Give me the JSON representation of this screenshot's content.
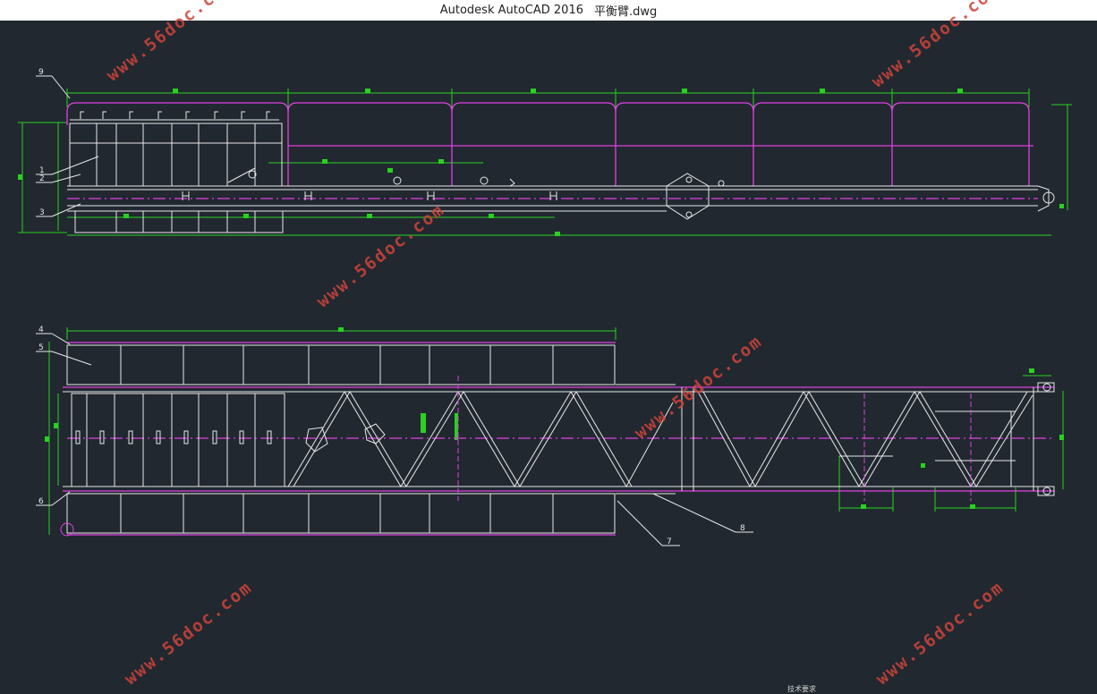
{
  "window": {
    "app_title": "Autodesk AutoCAD 2016",
    "file_name": "平衡臂.dwg"
  },
  "callouts": [
    "9",
    "1",
    "2",
    "3",
    "4",
    "5",
    "6",
    "7",
    "8"
  ],
  "watermark": "www.56doc.com",
  "notes_title": "技术要求",
  "colors": {
    "background": "#212830",
    "outline": "#e8e8e8",
    "accent_magenta": "#e040e0",
    "dimension_green": "#29d21f",
    "watermark": "#d0443a"
  }
}
